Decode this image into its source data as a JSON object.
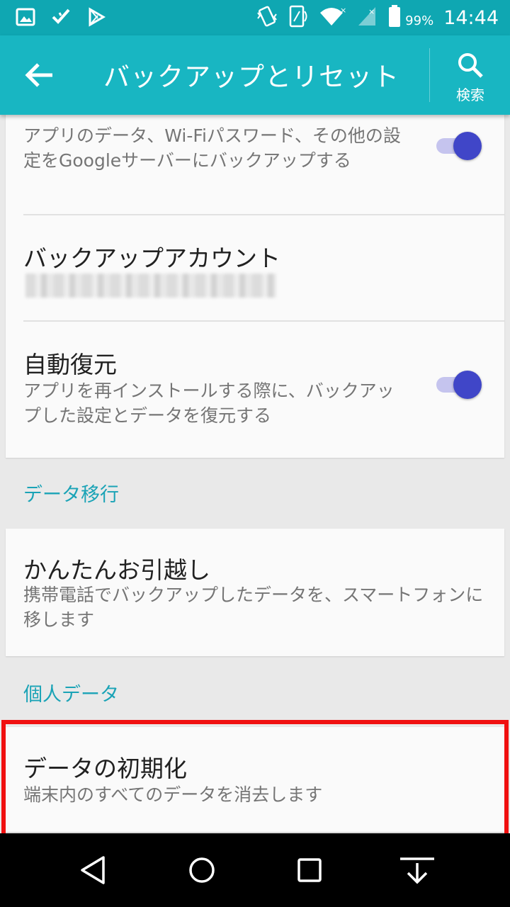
{
  "status": {
    "battery_pct": "99%",
    "time": "14:44",
    "left_icons": [
      "image-icon",
      "download-check-icon",
      "play-store-icon"
    ],
    "right_icons": [
      "vibrate-icon",
      "rotate-icon",
      "wifi-icon",
      "signal-icon",
      "battery-icon"
    ]
  },
  "appbar": {
    "title": "バックアップとリセット",
    "search_label": "検索"
  },
  "backup_card": {
    "data_backup": {
      "subtitle": "アプリのデータ、Wi-Fiパスワード、その他の設定をGoogleサーバーにバックアップする",
      "toggle_on": true
    },
    "backup_account": {
      "title": "バックアップアカウント"
    },
    "auto_restore": {
      "title": "自動復元",
      "subtitle": "アプリを再インストールする際に、バックアップした設定とデータを復元する",
      "toggle_on": true
    }
  },
  "sections": {
    "data_transfer": "データ移行",
    "personal_data": "個人データ"
  },
  "easy_move": {
    "title": "かんたんお引越し",
    "subtitle": "携帯電話でバックアップしたデータを、スマートフォンに移します"
  },
  "factory_reset": {
    "title": "データの初期化",
    "subtitle": "端末内のすべてのデータを消去します"
  },
  "colors": {
    "appbar": "#18b6c2",
    "statusbar": "#0fa7b2",
    "toggle_thumb": "#4046c8",
    "section_text": "#1aa3b6",
    "highlight": "#f01010"
  },
  "navbar": [
    "back-triangle-icon",
    "home-circle-icon",
    "recents-square-icon",
    "hide-keyboard-icon"
  ]
}
